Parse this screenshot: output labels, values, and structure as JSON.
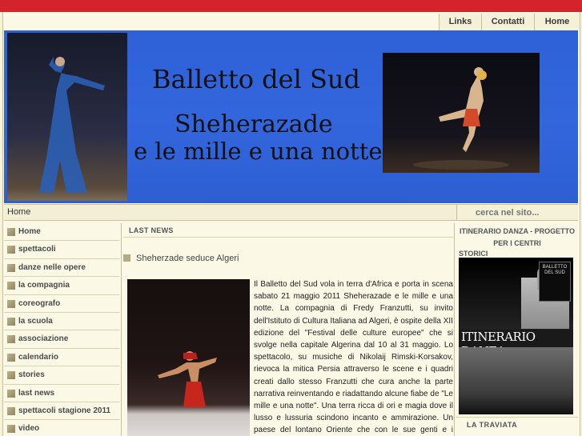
{
  "top_nav": {
    "links": "Links",
    "contatti": "Contatti",
    "home": "Home"
  },
  "banner": {
    "title": "Balletto del Sud",
    "subtitle_line1": "Sheherazade",
    "subtitle_line2": "e le mille e una notte"
  },
  "breadcrumb": "Home",
  "search": {
    "placeholder": "cerca nel sito..."
  },
  "sidebar": {
    "items": [
      "Home",
      "spettacoli",
      "danze nelle opere",
      "la compagnia",
      "coreografo",
      "la scuola",
      "associazione",
      "calendario",
      "stories",
      "last news",
      "spettacoli stagione 2011",
      "video"
    ]
  },
  "main": {
    "section_title": "LAST NEWS",
    "news_title": "Sheherzade seduce Algeri",
    "news_body": "Il Balletto del Sud vola in terra d'Africa e porta in scena sabato 21 maggio 2011 Sheherazade e le mille e una notte. La compagnia di Fredy Franzutti, su invito dell'Istituto di Cultura Italiana ad Algeri, è ospite della XII edizione del \"Festival delle culture europee\" che si svolge nella capitale Algerina dal 10 al 31 maggio. Lo spettacolo, su musiche di Nikolaij Rimski-Korsakov, rievoca la mitica Persia attraverso le scene e i quadri creati dallo stesso Franzutti che cura anche la parte narrativa reinventando e riadattando alcune fiabe de \"Le mille e una notte\". Una terra ricca di ori e magia dove il lusso e lussuria scindono incanto e ammirazione. Un paese del lontano Oriente che con le sue genti e i popoli del mare infonde fascino e mistero senza tempo."
  },
  "right": {
    "section1_line1": "ITINERARIO DANZA -",
    "section1_line2": "PROGETTO PER I CENTRI",
    "section1_line3": "STORICI",
    "ad_title": "ITINERARIO DANZA",
    "ad_card": "BALLETTO DEL SUD",
    "section2": "LA TRAVIATA"
  }
}
